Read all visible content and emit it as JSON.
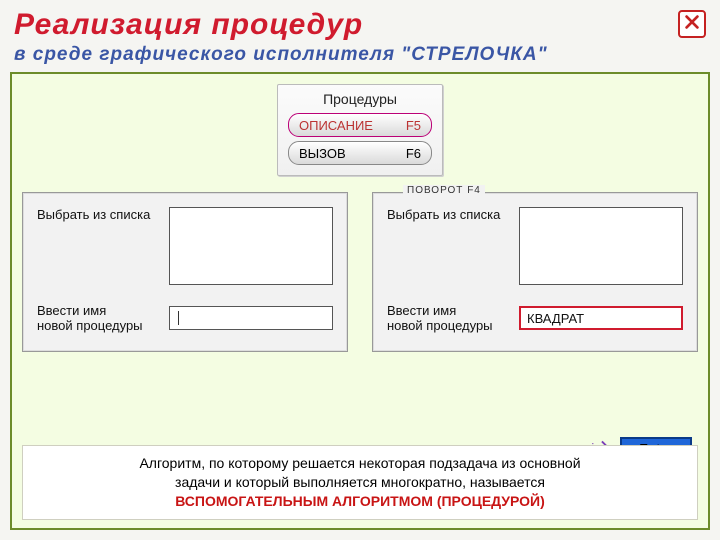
{
  "header": {
    "title": "Реализация  процедур",
    "subtitle": "в  среде  графического  исполнителя  \"СТРЕЛОЧКА\""
  },
  "proc_panel": {
    "title": "Процедуры",
    "btn1_label": "ОПИСАНИЕ",
    "btn1_key": "F5",
    "btn2_label": "ВЫЗОВ",
    "btn2_key": "F6"
  },
  "left_dialog": {
    "top_fragment": "",
    "select_label": "Выбрать из списка",
    "name_label_1": "Ввести имя",
    "name_label_2": "новой процедуры",
    "value": ""
  },
  "right_dialog": {
    "top_fragment": "ПОВОРОТ  F4",
    "select_label": "Выбрать из списка",
    "name_label_1": "Ввести имя",
    "name_label_2": "новой процедуры",
    "value": "КВАДРАТ"
  },
  "enter": {
    "label": "Enter"
  },
  "definition": {
    "line1": "Алгоритм, по которому решается некоторая подзадача из основной",
    "line2": "задачи и который выполняется многократно, называется",
    "line3": "ВСПОМОГАТЕЛЬНЫМ АЛГОРИТМОМ (ПРОЦЕДУРОЙ)"
  }
}
